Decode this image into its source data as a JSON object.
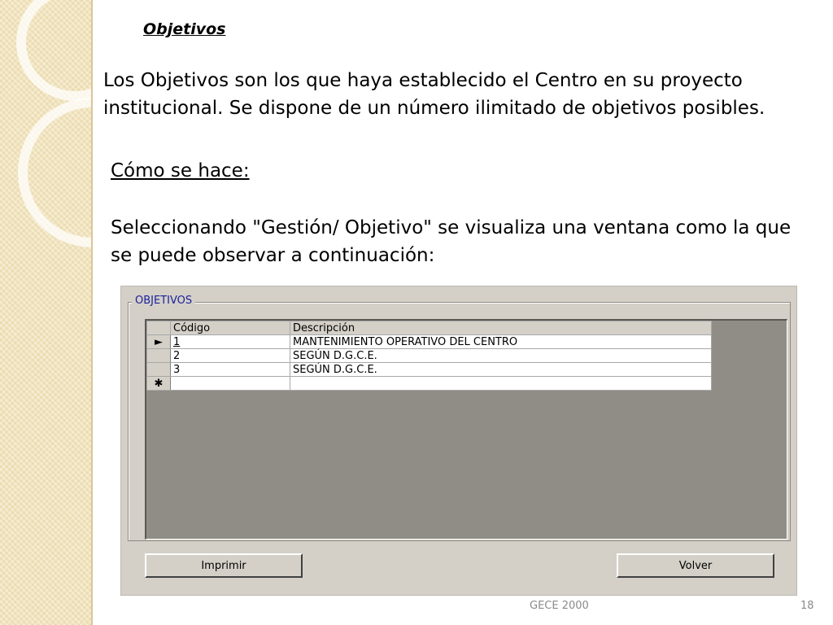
{
  "slide": {
    "title": "Objetivos",
    "intro": "Los Objetivos son los que haya establecido el Centro en su proyecto institucional. Se dispone de un número ilimitado de objetivos posibles.",
    "howto_heading": "Cómo se hace:",
    "steps": "Seleccionando \"Gestión/ Objetivo\" se visualiza una ventana como la que se puede observar a continuación:"
  },
  "window": {
    "group_label": "OBJETIVOS",
    "columns": [
      "Código",
      "Descripción"
    ],
    "rows": [
      {
        "indicator": "►",
        "code": "1",
        "description": "MANTENIMIENTO OPERATIVO DEL CENTRO"
      },
      {
        "indicator": "",
        "code": "2",
        "description": "SEGÚN D.G.C.E."
      },
      {
        "indicator": "",
        "code": "3",
        "description": "SEGÚN D.G.C.E."
      },
      {
        "indicator": "✱",
        "code": "",
        "description": ""
      }
    ],
    "buttons": {
      "print_label": "Imprimir",
      "back_label": "Volver"
    }
  },
  "footer": {
    "center": "GECE 2000",
    "page_number": "18"
  },
  "colors": {
    "side_strip": "#f1e4bd",
    "window_bg": "#d4d0c8",
    "group_label": "#1a1f9a",
    "footer_text": "#8a8a8a"
  }
}
